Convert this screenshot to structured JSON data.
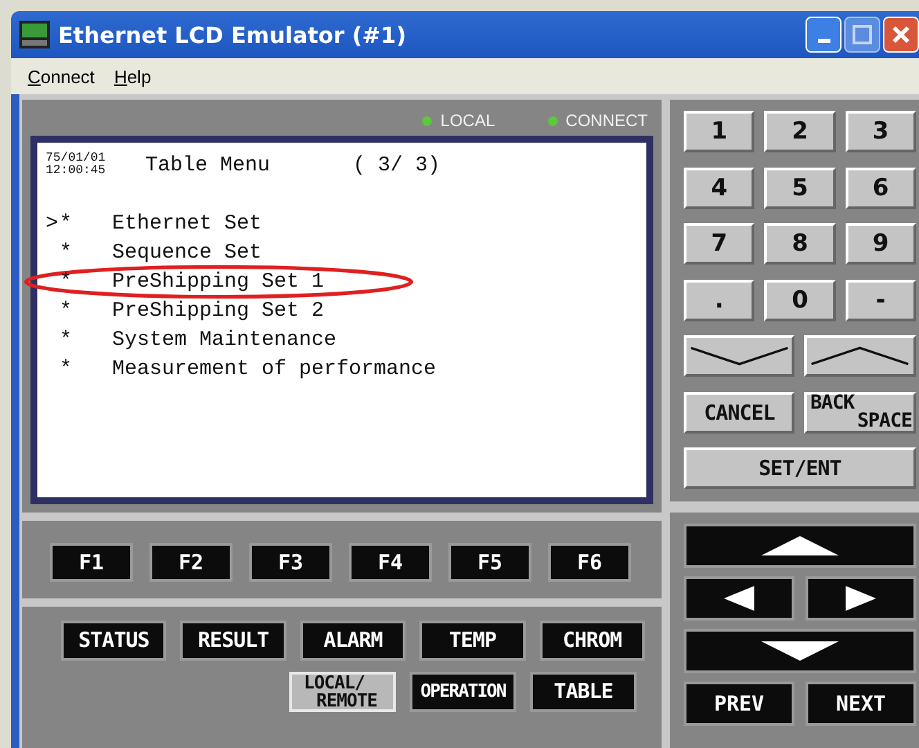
{
  "window": {
    "title": "Ethernet LCD Emulator (#1)"
  },
  "menu": [
    "Connect",
    "Help"
  ],
  "indicators": [
    {
      "label": "LOCAL",
      "on": true
    },
    {
      "label": "CONNECT",
      "on": true
    }
  ],
  "lcd": {
    "cursor_symbol": ">",
    "bullet": "*",
    "date": "75/01/01",
    "time": "12:00:45",
    "title": "Table Menu",
    "page": "( 3/ 3)",
    "items": [
      {
        "label": "Ethernet Set",
        "cursor": true,
        "circled": false
      },
      {
        "label": "Sequence Set",
        "cursor": false,
        "circled": false
      },
      {
        "label": "PreShipping Set 1",
        "cursor": false,
        "circled": true
      },
      {
        "label": "PreShipping Set 2",
        "cursor": false,
        "circled": false
      },
      {
        "label": "System Maintenance",
        "cursor": false,
        "circled": false
      },
      {
        "label": "Measurement of performance",
        "cursor": false,
        "circled": false
      }
    ]
  },
  "function_keys": [
    "F1",
    "F2",
    "F3",
    "F4",
    "F5",
    "F6"
  ],
  "mode_keys": [
    [
      {
        "lines": [
          "STATUS"
        ],
        "selected": false
      },
      {
        "lines": [
          "RESULT"
        ],
        "selected": false
      },
      {
        "lines": [
          "ALARM"
        ],
        "selected": false
      },
      {
        "lines": [
          "TEMP"
        ],
        "selected": false
      },
      {
        "lines": [
          "CHROM"
        ],
        "selected": false
      }
    ],
    [
      {
        "lines": [
          "LOCAL/",
          "REMOTE"
        ],
        "selected": true
      },
      {
        "lines": [
          "OPERATION"
        ],
        "selected": false
      },
      {
        "lines": [
          "TABLE"
        ],
        "selected": false
      }
    ]
  ],
  "keypad": [
    {
      "kind": "key",
      "lines": [
        "1"
      ]
    },
    {
      "kind": "key",
      "lines": [
        "2"
      ]
    },
    {
      "kind": "key",
      "lines": [
        "3"
      ]
    },
    {
      "kind": "key",
      "lines": [
        "4"
      ]
    },
    {
      "kind": "key",
      "lines": [
        "5"
      ]
    },
    {
      "kind": "key",
      "lines": [
        "6"
      ]
    },
    {
      "kind": "key",
      "lines": [
        "7"
      ]
    },
    {
      "kind": "key",
      "lines": [
        "8"
      ]
    },
    {
      "kind": "key",
      "lines": [
        "9"
      ]
    },
    {
      "kind": "key",
      "lines": [
        "."
      ]
    },
    {
      "kind": "key",
      "lines": [
        "0"
      ]
    },
    {
      "kind": "key",
      "lines": [
        "-"
      ]
    },
    {
      "kind": "down"
    },
    {
      "kind": "up"
    },
    {
      "kind": "half",
      "lines": [
        "CANCEL"
      ]
    },
    {
      "kind": "half",
      "lines": [
        "BACK",
        "SPACE"
      ]
    },
    {
      "kind": "wide",
      "lines": [
        "SET/ENT"
      ]
    }
  ],
  "nav": [
    {
      "kind": "up"
    },
    {
      "kind": "left"
    },
    {
      "kind": "right"
    },
    {
      "kind": "down"
    },
    {
      "kind": "text",
      "label": "PREV"
    },
    {
      "kind": "text",
      "label": "NEXT"
    }
  ]
}
